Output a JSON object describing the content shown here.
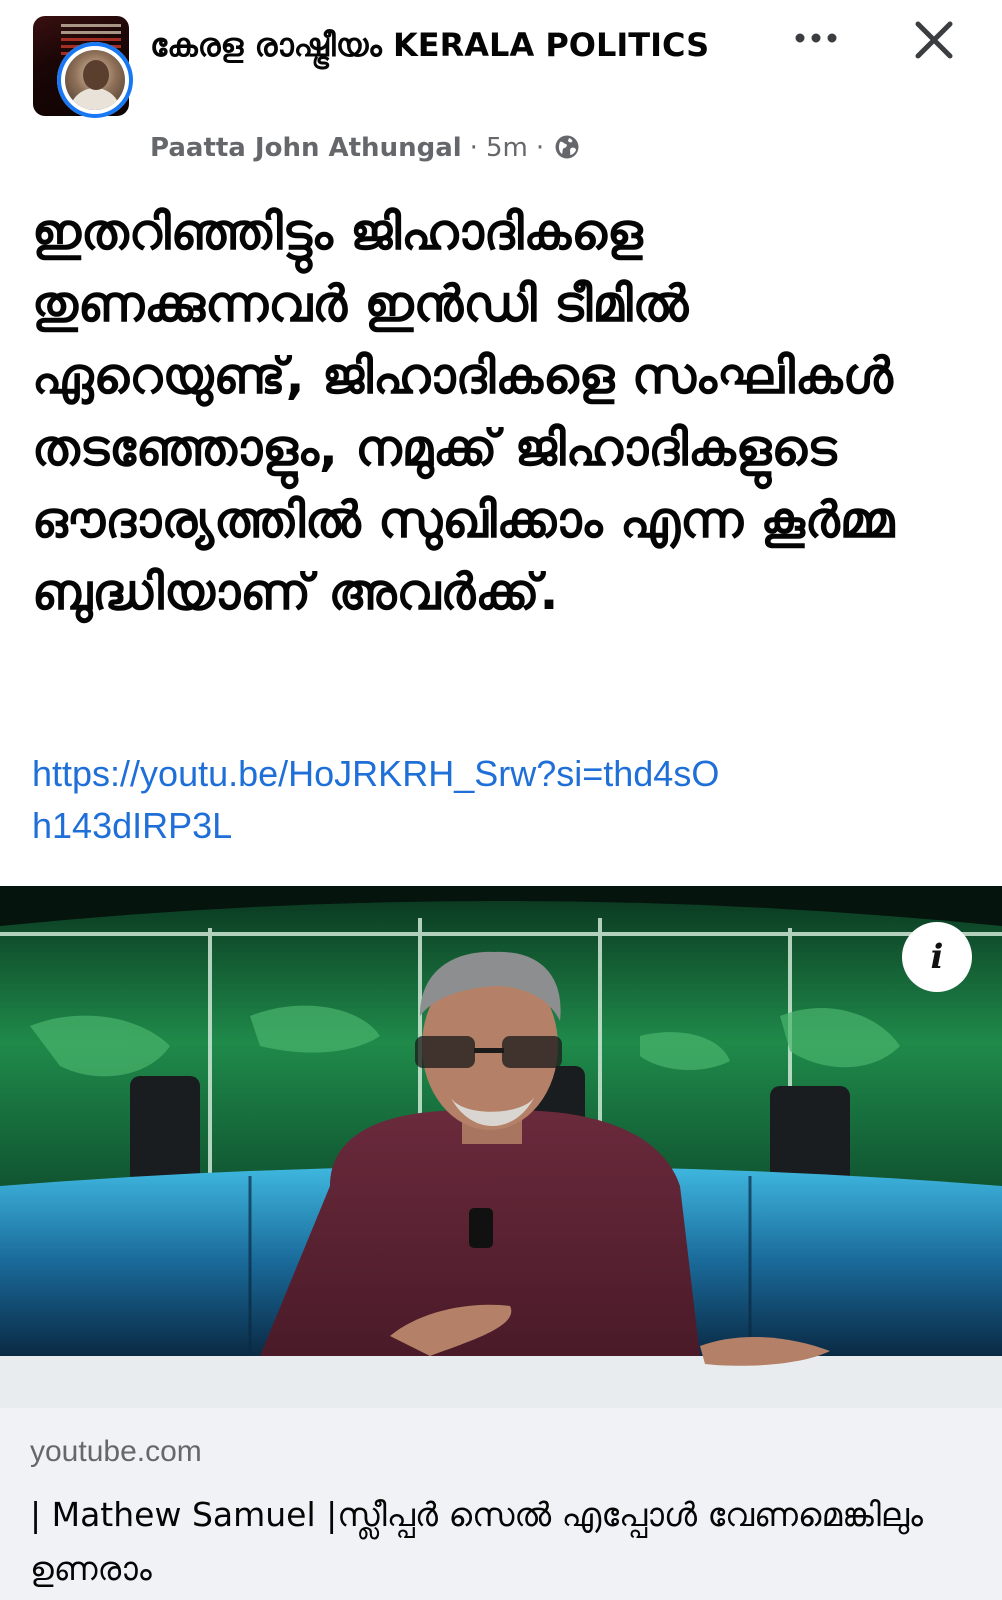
{
  "header": {
    "group_name": "കേരള രാഷ്ട്രീയം  KERALA POLITICS",
    "author": "Paatta John Athungal",
    "separator": "·",
    "time": "5m",
    "visibility_icon": "globe-icon",
    "more_icon": "ellipsis-icon",
    "close_icon": "close-icon"
  },
  "post": {
    "text": "ഇതറിഞ്ഞിട്ടും ജിഹാദികളെ തുണക്കുന്നവർ ഇൻഡി ടീമിൽ ഏറെയുണ്ട്, ജിഹാദികളെ സംഘികൾ തടഞ്ഞോളും, നമുക്ക് ജിഹാദികളുടെ ഔദാര്യത്തിൽ സുഖിക്കാം എന്ന കൂർമ്മ ബുദ്ധിയാണ് അവർക്ക്.",
    "link": "https://youtu.be/HoJRKRH_Srw?si=thd4sOh143dIRP3L"
  },
  "preview": {
    "info_label": "i",
    "domain": "youtube.com",
    "title": "| Mathew Samuel |സ്ലീപ്പർ സെൽ എപ്പോൾ വേണമെങ്കിലും ഉണരാം"
  },
  "colors": {
    "link": "#1f6fd8",
    "meta": "#65676b",
    "footer_bg": "#f0f2f5",
    "avatar_ring": "#1877f2"
  }
}
